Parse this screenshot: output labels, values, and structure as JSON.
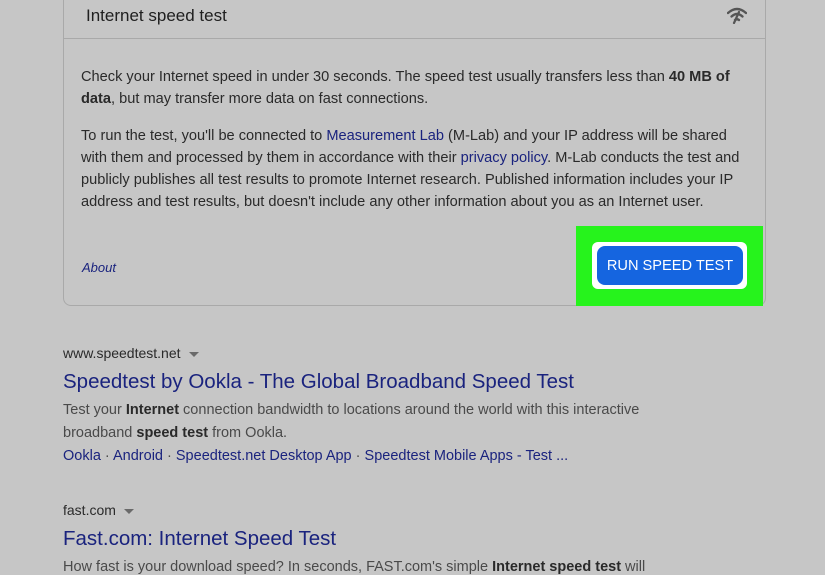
{
  "card": {
    "title": "Internet speed test",
    "para1_a": "Check your Internet speed in under 30 seconds. The speed test usually transfers less than ",
    "para1_bold": "40 MB of data",
    "para1_b": ", but may transfer more data on fast connections.",
    "para2_a": "To run the test, you'll be connected to ",
    "para2_link1": "Measurement Lab",
    "para2_b": " (M-Lab) and your IP address will be shared with them and processed by them in accordance with their ",
    "para2_link2": "privacy policy",
    "para2_c": ". M-Lab conducts the test and publicly publishes all test results to promote Internet research. Published information includes your IP address and test results, but doesn't include any other information about you as an Internet user.",
    "about": "About",
    "run_button": "RUN SPEED TEST",
    "highlight_color": "#26f31c",
    "button_color": "#1565e0"
  },
  "results": [
    {
      "url": "www.speedtest.net",
      "title": "Speedtest by Ookla - The Global Broadband Speed Test",
      "snippet_a": "Test your ",
      "snippet_b1": "Internet",
      "snippet_c": " connection bandwidth to locations around the world with this interactive broadband ",
      "snippet_b2": "speed test",
      "snippet_d": " from Ookla.",
      "sitelinks": [
        "Ookla",
        "Android",
        "Speedtest.net Desktop App",
        "Speedtest Mobile Apps - Test ..."
      ]
    },
    {
      "url": "fast.com",
      "title": "Fast.com: Internet Speed Test",
      "snippet_a": "How fast is your download speed? In seconds, FAST.com's simple ",
      "snippet_b1": "Internet speed test",
      "snippet_c": " will"
    }
  ]
}
